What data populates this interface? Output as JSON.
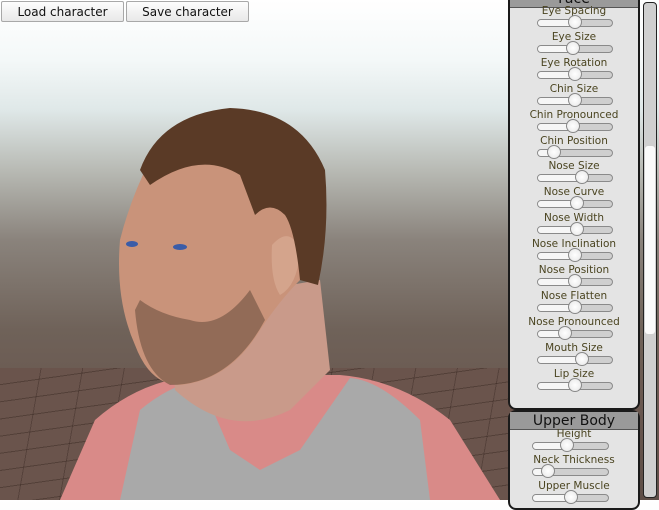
{
  "toolbar": {
    "load_label": "Load character",
    "save_label": "Save character"
  },
  "face_panel": {
    "title": "Face",
    "sliders": [
      {
        "label": "Eye Spacing",
        "value": 0.5
      },
      {
        "label": "Eye Size",
        "value": 0.47
      },
      {
        "label": "Eye Rotation",
        "value": 0.5
      },
      {
        "label": "Chin Size",
        "value": 0.5
      },
      {
        "label": "Chin Pronounced",
        "value": 0.47
      },
      {
        "label": "Chin Position",
        "value": 0.22
      },
      {
        "label": "Nose Size",
        "value": 0.6
      },
      {
        "label": "Nose Curve",
        "value": 0.53
      },
      {
        "label": "Nose Width",
        "value": 0.53
      },
      {
        "label": "Nose Inclination",
        "value": 0.5
      },
      {
        "label": "Nose Position",
        "value": 0.5
      },
      {
        "label": "Nose Flatten",
        "value": 0.5
      },
      {
        "label": "Nose Pronounced",
        "value": 0.37
      },
      {
        "label": "Mouth Size",
        "value": 0.6
      },
      {
        "label": "Lip Size",
        "value": 0.5
      }
    ]
  },
  "upper_body_panel": {
    "title": "Upper Body",
    "sliders": [
      {
        "label": "Height",
        "value": 0.45
      },
      {
        "label": "Neck Thickness",
        "value": 0.2
      },
      {
        "label": "Upper Muscle",
        "value": 0.5
      }
    ]
  },
  "scrollbar": {
    "position": 0.3
  }
}
